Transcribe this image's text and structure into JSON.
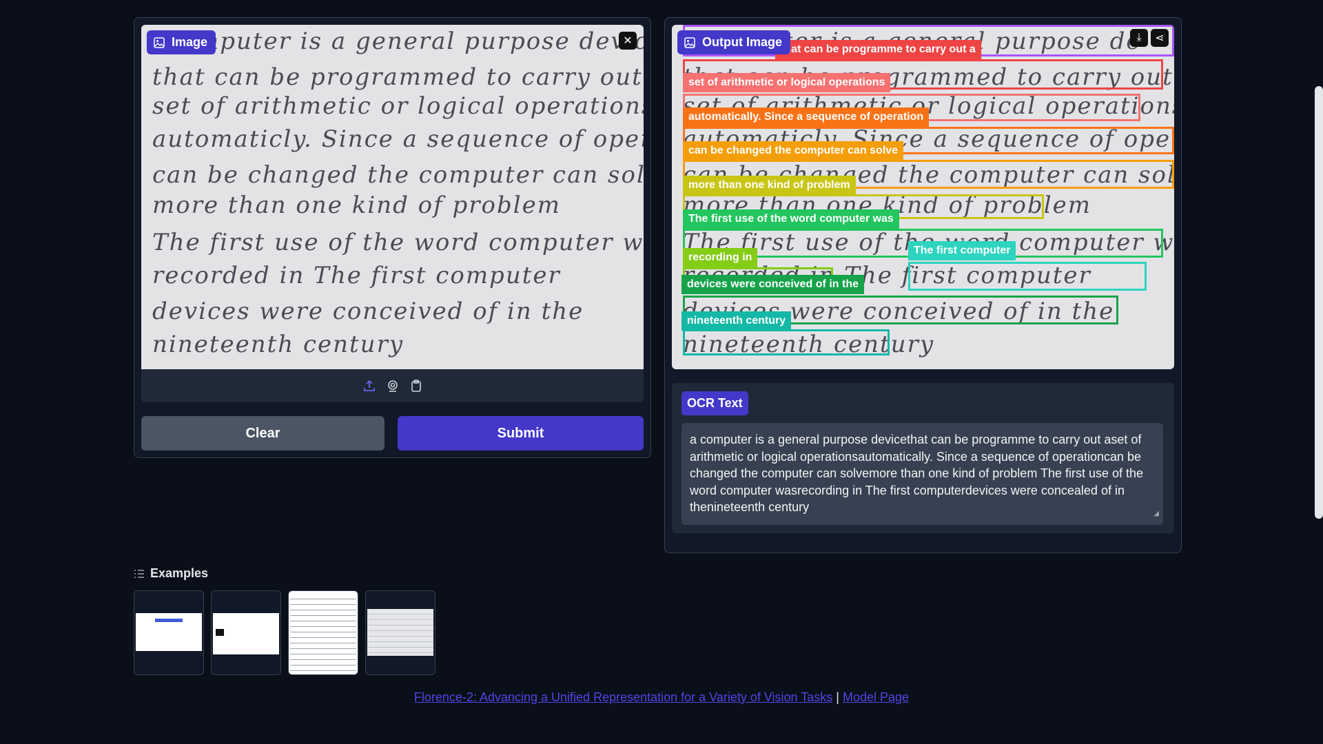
{
  "input": {
    "label": "Image",
    "handwriting_lines": [
      "mputer  is  a  general  purpose  devic",
      "that  can  be  programmed  to  carry  out  a",
      "set  of  arithmetic  or  logical  operations",
      "automaticly. Since  a  sequence  of  operation",
      "can  be  changed  the  computer  can  solve",
      "more  than  one  kind  of  problem",
      "The  first  use  of  the  word  computer  was",
      "recorded   in        The  first  computer",
      "devices   were  conceived  of  in  the",
      "nineteenth  century"
    ]
  },
  "buttons": {
    "clear": "Clear",
    "submit": "Submit"
  },
  "output": {
    "label": "Output Image",
    "handwriting_lines": [
      "mputer  is  a  general  purpose  de",
      "that  can  be  programmed  to  carry  out  a",
      "set  of  arithmetic  or  logical  operations",
      "automaticly. Since  a  sequence  of  operation",
      "can  be  changed  the  computer  can  solve",
      "more  than  one  kind  of  problem",
      "The  first  use  of  the  word  computer  was",
      "recorded   in        The  first  computer",
      "devices   were  conceived  of  in  the",
      "nineteenth  century"
    ],
    "regions": [
      {
        "text": "a computer is a general purpose device",
        "color": "#a855f7"
      },
      {
        "text": "that can be programme to carry out a",
        "color": "#ef4444"
      },
      {
        "text": "set of arithmetic or logical operations",
        "color": "#f87171"
      },
      {
        "text": "automatically. Since a sequence of operation",
        "color": "#f97316"
      },
      {
        "text": "can be changed the computer can solve",
        "color": "#f59e0b"
      },
      {
        "text": "more than one kind of problem",
        "color": "#c9c516"
      },
      {
        "text": "The first use of the word computer was",
        "color": "#22c55e"
      },
      {
        "text": "recording in",
        "color": "#84cc16"
      },
      {
        "text": "The first computer",
        "color": "#2dd4bf"
      },
      {
        "text": "devices were conceived of in the",
        "color": "#16a34a"
      },
      {
        "text": "nineteenth century",
        "color": "#14b8a6"
      }
    ]
  },
  "ocr": {
    "label": "OCR Text",
    "text": "a computer is a general purpose devicethat can be programme to carry out aset of arithmetic or logical operationsautomatically. Since a sequence of operationcan be changed the computer can solvemore than one kind of problem The first use of the word computer wasrecording in The first computerdevices were concealed of in thenineteenth century"
  },
  "examples": {
    "title": "Examples"
  },
  "footer": {
    "link1": "Florence-2: Advancing a Unified Representation for a Variety of Vision Tasks",
    "separator": "|",
    "link2": "Model Page"
  }
}
